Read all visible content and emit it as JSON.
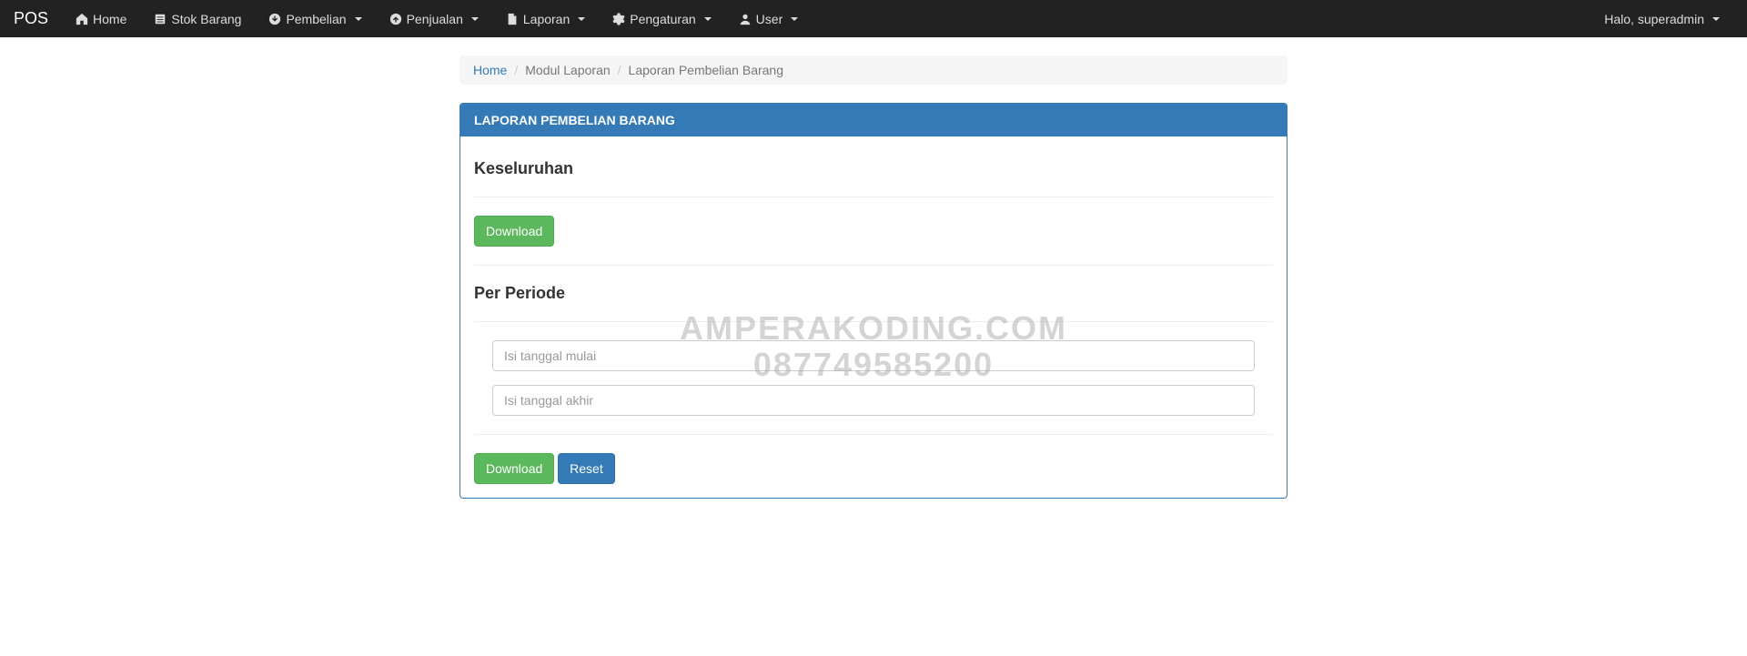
{
  "navbar": {
    "brand": "POS",
    "items": [
      {
        "label": "Home",
        "icon": "home",
        "dropdown": false
      },
      {
        "label": "Stok Barang",
        "icon": "list",
        "dropdown": false
      },
      {
        "label": "Pembelian",
        "icon": "arrow-down-circle",
        "dropdown": true
      },
      {
        "label": "Penjualan",
        "icon": "arrow-up-circle",
        "dropdown": true
      },
      {
        "label": "Laporan",
        "icon": "file",
        "dropdown": true
      },
      {
        "label": "Pengaturan",
        "icon": "gear",
        "dropdown": true
      },
      {
        "label": "User",
        "icon": "user",
        "dropdown": true
      }
    ],
    "greeting": "Halo, superadmin"
  },
  "breadcrumb": {
    "home": "Home",
    "modul": "Modul Laporan",
    "current": "Laporan Pembelian Barang"
  },
  "panel": {
    "title": "LAPORAN PEMBELIAN BARANG"
  },
  "sections": {
    "all": {
      "title": "Keseluruhan",
      "download": "Download"
    },
    "period": {
      "title": "Per Periode",
      "start_placeholder": "Isi tanggal mulai",
      "end_placeholder": "Isi tanggal akhir",
      "download": "Download",
      "reset": "Reset"
    }
  },
  "watermark": {
    "line1": "AMPERAKODING.COM",
    "line2": "087749585200"
  }
}
